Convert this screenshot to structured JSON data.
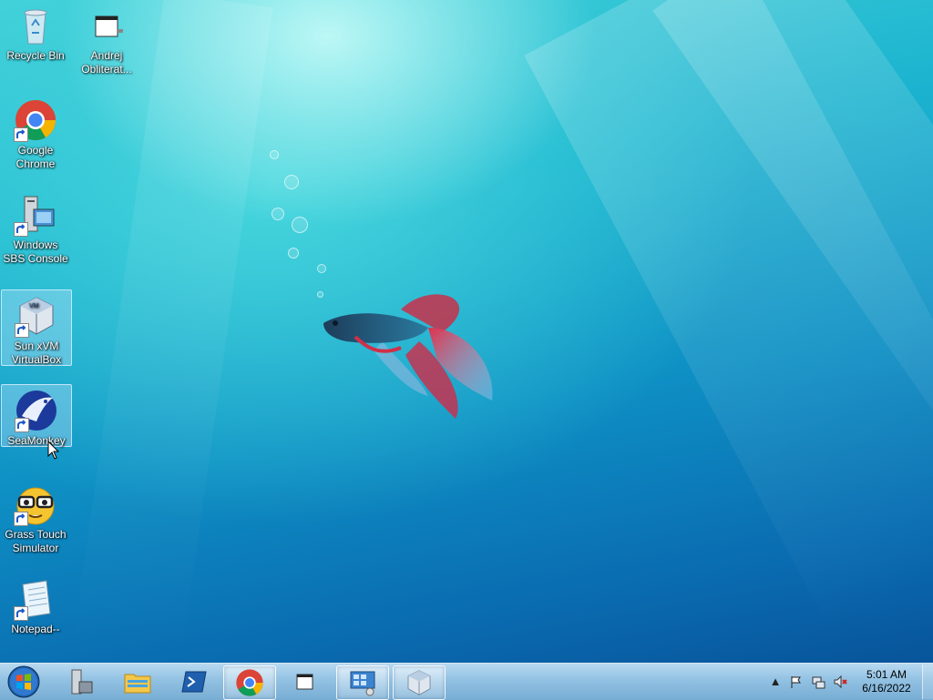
{
  "desktop": {
    "icons": [
      {
        "label": "Recycle Bin",
        "icon": "recycle-bin-icon"
      },
      {
        "label": "Andrej Obliterat...",
        "icon": "program-window-icon"
      },
      {
        "label": "Google Chrome",
        "icon": "chrome-icon"
      },
      {
        "label": "Windows SBS Console",
        "icon": "sbs-console-icon"
      },
      {
        "label": "Sun xVM VirtualBox",
        "icon": "virtualbox-icon"
      },
      {
        "label": "SeaMonkey",
        "icon": "seamonkey-icon"
      },
      {
        "label": "Grass Touch Simulator",
        "icon": "nerd-face-icon"
      },
      {
        "label": "Notepad--",
        "icon": "notepad-icon"
      }
    ]
  },
  "taskbar": {
    "start": "start-orb-icon",
    "pinned": [
      {
        "name": "server-manager",
        "icon": "server-icon"
      },
      {
        "name": "explorer",
        "icon": "folder-icon"
      },
      {
        "name": "powershell",
        "icon": "powershell-icon"
      },
      {
        "name": "chrome",
        "icon": "chrome-icon",
        "active": true
      },
      {
        "name": "window-program",
        "icon": "program-window-icon"
      },
      {
        "name": "sbs-console",
        "icon": "sbs-console-icon",
        "active": true
      },
      {
        "name": "virtualbox",
        "icon": "virtualbox-icon",
        "active": true
      }
    ],
    "tray": {
      "icons": [
        "show-hidden-icons-icon",
        "action-center-flag-icon",
        "network-icon",
        "volume-muted-icon"
      ],
      "time": "5:01 AM",
      "date": "6/16/2022"
    }
  }
}
